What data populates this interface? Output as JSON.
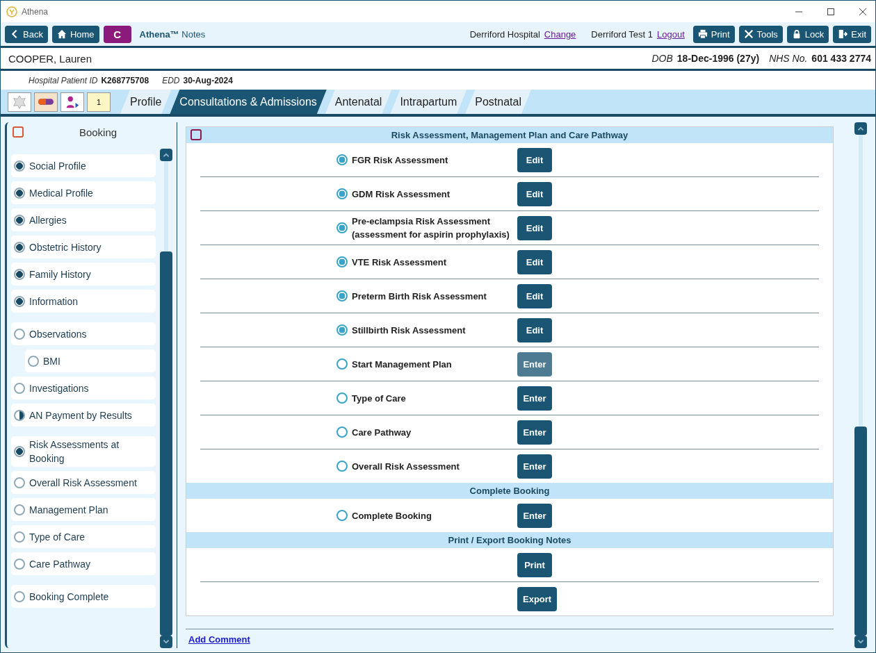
{
  "window": {
    "title": "Athena"
  },
  "toolbar": {
    "back": "Back",
    "home": "Home",
    "c_button": "C",
    "app_name": "**Athena™** Notes",
    "hospital": "Derriford Hospital",
    "change": "Change",
    "user": "Derriford Test 1",
    "logout": "Logout",
    "actions": [
      {
        "kind": "print",
        "label": "Print"
      },
      {
        "kind": "tools",
        "label": "Tools"
      },
      {
        "kind": "lock",
        "label": "Lock"
      },
      {
        "kind": "exit",
        "label": "Exit"
      }
    ]
  },
  "patient": {
    "name": "COOPER, Lauren",
    "dob_label": "DOB",
    "dob": "18-Dec-1996 (27y)",
    "nhs_label": "NHS No.",
    "nhs": "601 433 2774",
    "hospital_id_label": "Hospital Patient ID",
    "hospital_id": "K268775708",
    "edd_label": "EDD",
    "edd": "30-Aug-2024"
  },
  "quick_icons": [
    {
      "kind": "flower"
    },
    {
      "kind": "pill"
    },
    {
      "kind": "person"
    },
    {
      "kind": "note",
      "badge": "1"
    }
  ],
  "tabs": [
    {
      "label": "Profile",
      "selected": false
    },
    {
      "label": "Consultations & Admissions",
      "selected": true
    },
    {
      "label": "Antenatal",
      "selected": false
    },
    {
      "label": "Intrapartum",
      "selected": false
    },
    {
      "label": "Postnatal",
      "selected": false
    }
  ],
  "sidebar": {
    "title": "Booking",
    "groups": [
      {
        "items": [
          {
            "label": "Social Profile",
            "kind": "complete"
          },
          {
            "label": "Medical Profile",
            "kind": "complete"
          },
          {
            "label": "Allergies",
            "kind": "complete"
          },
          {
            "label": "Obstetric History",
            "kind": "complete"
          },
          {
            "label": "Family History",
            "kind": "complete"
          },
          {
            "label": "Information",
            "kind": "complete"
          }
        ]
      },
      {
        "items": [
          {
            "label": "Observations",
            "kind": "empty",
            "children": [
              {
                "label": "BMI",
                "kind": "empty"
              }
            ]
          },
          {
            "label": "Investigations",
            "kind": "empty"
          },
          {
            "label": "AN Payment by Results",
            "kind": "partial"
          }
        ]
      },
      {
        "items": [
          {
            "label": "Risk Assessments at Booking",
            "kind": "complete"
          },
          {
            "label": "Overall Risk Assessment",
            "kind": "empty"
          },
          {
            "label": "Management Plan",
            "kind": "empty"
          },
          {
            "label": "Type of Care",
            "kind": "empty"
          },
          {
            "label": "Care Pathway",
            "kind": "empty"
          }
        ]
      },
      {
        "items": [
          {
            "label": "Booking Complete",
            "kind": "empty"
          }
        ]
      }
    ]
  },
  "sections": [
    {
      "title": "Risk Assessment, Management Plan and Care Pathway",
      "rows": [
        {
          "label": "FGR Risk Assessment",
          "done": true,
          "button": "Edit",
          "disabled": false
        },
        {
          "label": "GDM Risk Assessment",
          "done": true,
          "button": "Edit",
          "disabled": false
        },
        {
          "label": "Pre-eclampsia Risk Assessment (assessment for aspirin prophylaxis)",
          "done": true,
          "button": "Edit",
          "disabled": false
        },
        {
          "label": "VTE Risk Assessment",
          "done": true,
          "button": "Edit",
          "disabled": false
        },
        {
          "label": "Preterm Birth Risk Assessment",
          "done": true,
          "button": "Edit",
          "disabled": false
        },
        {
          "label": "Stillbirth Risk Assessment",
          "done": true,
          "button": "Edit",
          "disabled": false
        },
        {
          "label": "Start Management Plan",
          "done": false,
          "button": "Enter",
          "disabled": true
        },
        {
          "label": "Type of Care",
          "done": false,
          "button": "Enter",
          "disabled": false
        },
        {
          "label": "Care Pathway",
          "done": false,
          "button": "Enter",
          "disabled": false
        },
        {
          "label": "Overall Risk Assessment",
          "done": false,
          "button": "Enter",
          "disabled": false
        }
      ]
    },
    {
      "title": "Complete Booking",
      "rows": [
        {
          "label": "Complete Booking",
          "done": false,
          "button": "Enter",
          "disabled": false
        }
      ]
    },
    {
      "title": "Print / Export Booking Notes",
      "rows": [
        {
          "button": "Print",
          "disabled": false
        },
        {
          "button": "Export",
          "disabled": false
        }
      ]
    }
  ],
  "add_comment": "Add Comment"
}
